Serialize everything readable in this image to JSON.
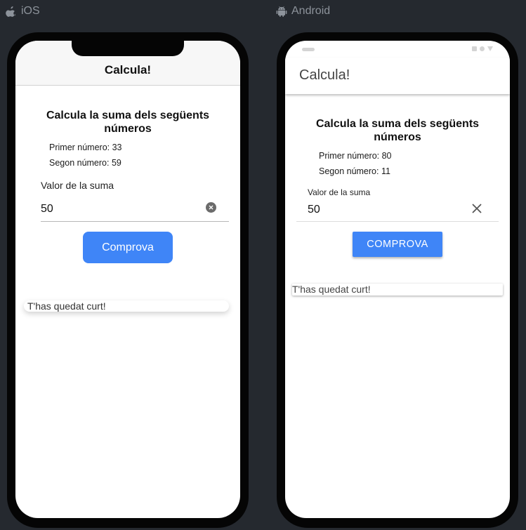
{
  "platforms": {
    "ios": {
      "label": "iOS",
      "icon": "apple-icon"
    },
    "android": {
      "label": "Android",
      "icon": "android-icon"
    }
  },
  "ios_app": {
    "nav_title": "Calcula!",
    "heading": "Calcula la suma dels següents números",
    "first_number": "Primer número: 33",
    "second_number": "Segon número: 59",
    "input_label": "Valor de la suma",
    "input_value": "50",
    "button_label": "Comprova",
    "toast_message": "T'has quedat curt!"
  },
  "android_app": {
    "app_bar_title": "Calcula!",
    "heading": "Calcula la suma dels següents números",
    "first_number": "Primer número: 80",
    "second_number": "Segon número: 11",
    "input_label": "Valor de la suma",
    "input_value": "50",
    "button_label": "COMPROVA",
    "toast_message": "T'has quedat curt!"
  },
  "colors": {
    "background": "#25292f",
    "accent": "#3f85f7",
    "device_frame": "#050505"
  }
}
